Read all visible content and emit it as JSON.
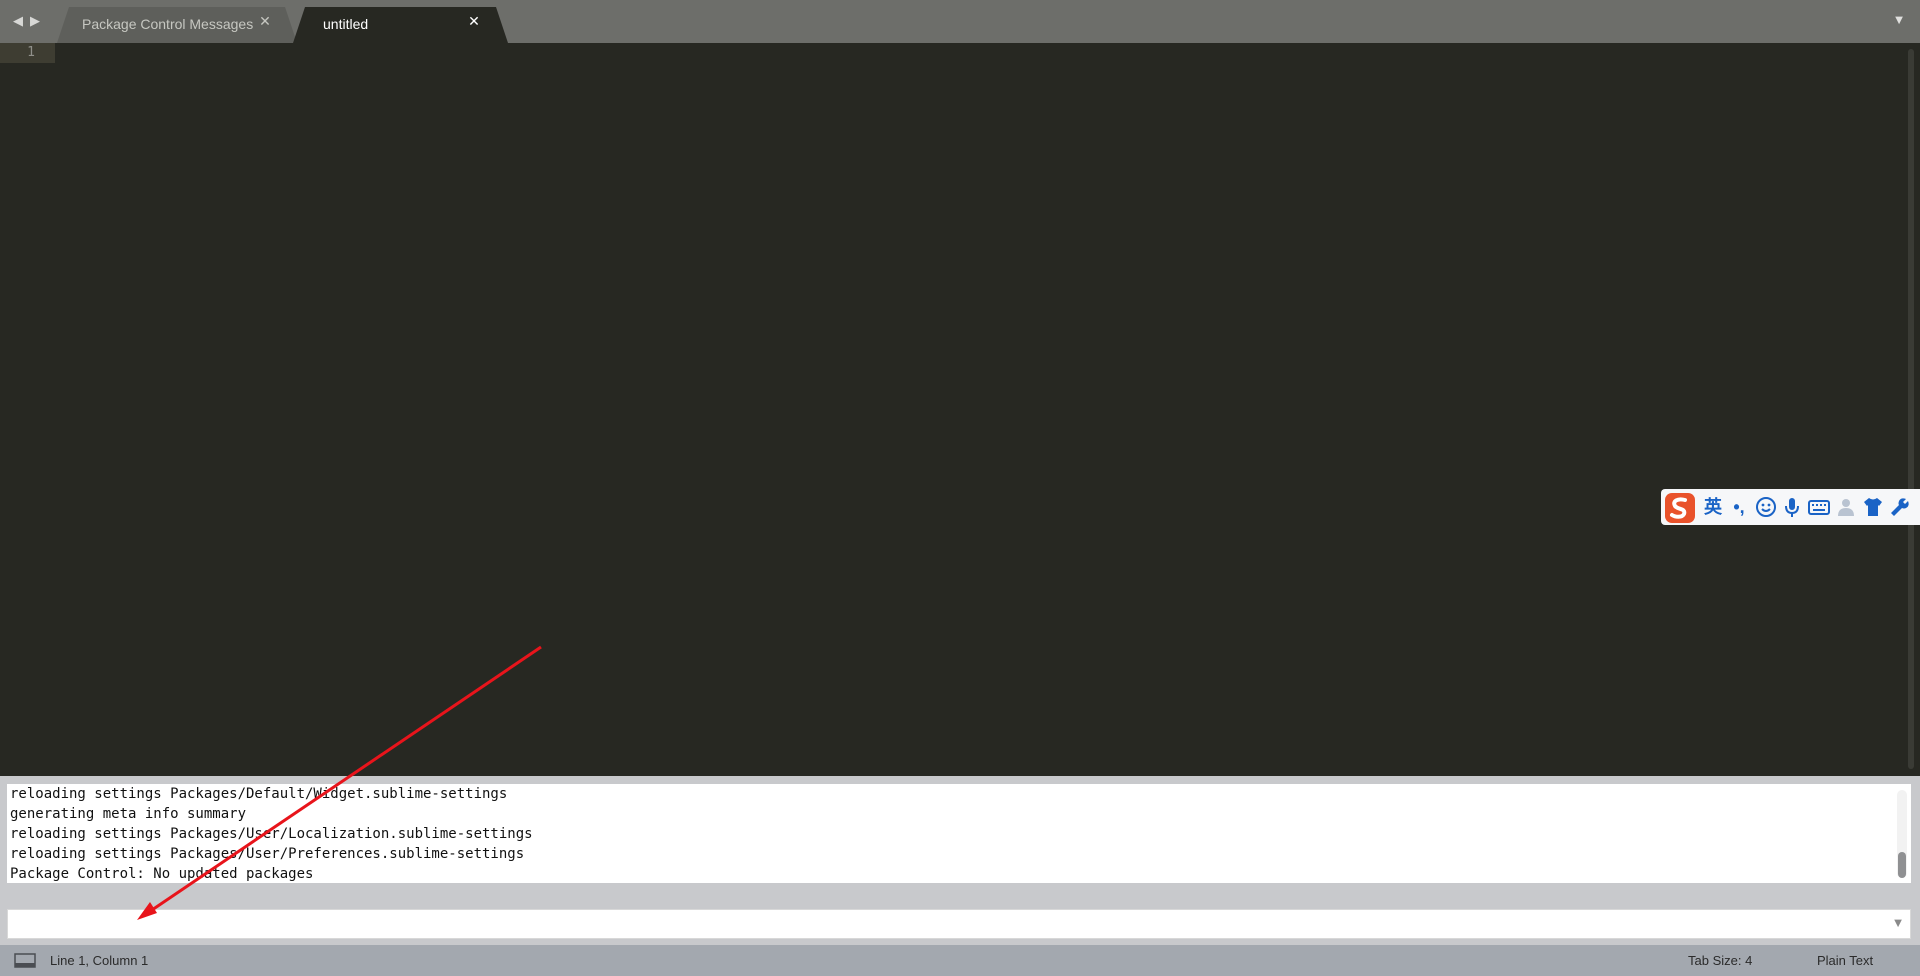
{
  "tabbar": {
    "tabs": [
      {
        "label": "Package Control Messages",
        "active": false
      },
      {
        "label": "untitled",
        "active": true
      }
    ],
    "close_glyph": "✕",
    "back_icon": "triangle-left-icon",
    "forward_icon": "triangle-right-icon",
    "dropdown_icon": "triangle-down-icon"
  },
  "editor": {
    "line_numbers": [
      "1"
    ],
    "theme_background": "#272822"
  },
  "ime_toolbar": {
    "lang_label": "英",
    "punct_label": "•,",
    "icons": [
      "sogou-logo-icon",
      "emoji-icon",
      "microphone-icon",
      "keyboard-icon",
      "user-icon",
      "skin-shirt-icon",
      "wrench-icon"
    ]
  },
  "console": {
    "lines": [
      "reloading settings Packages/Default/Widget.sublime-settings",
      "generating meta info summary",
      "reloading settings Packages/User/Localization.sublime-settings",
      "reloading settings Packages/User/Preferences.sublime-settings",
      "Package Control: No updated packages"
    ],
    "input_value": ""
  },
  "status_bar": {
    "position": "Line 1, Column 1",
    "tab_size": "Tab Size: 4",
    "syntax": "Plain Text"
  },
  "annotation": {
    "color": "#e8141b"
  }
}
